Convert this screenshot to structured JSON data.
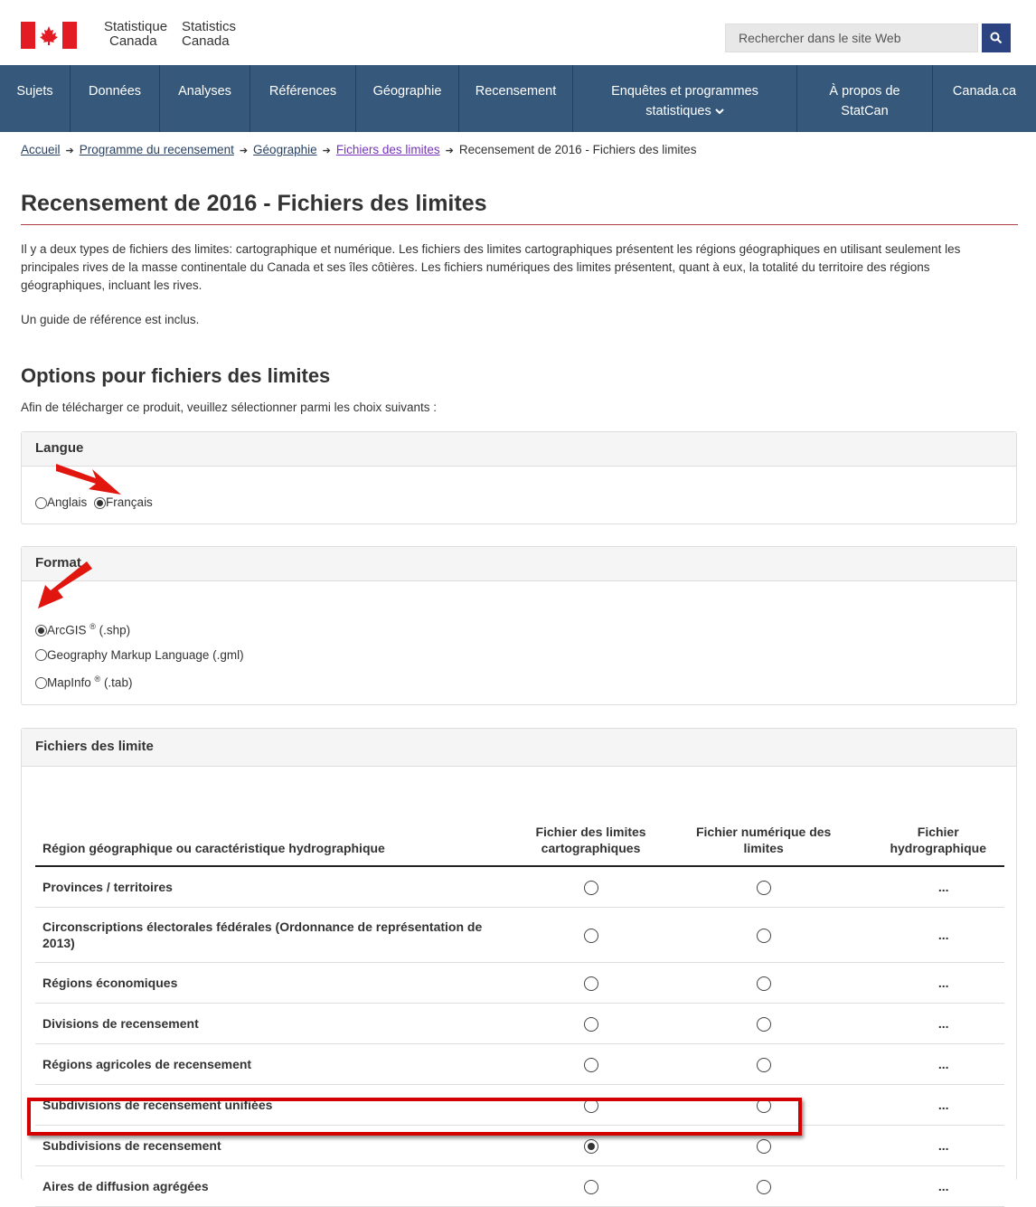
{
  "header": {
    "signature_fr": [
      "Statistique",
      "Canada"
    ],
    "signature_en": [
      "Statistics",
      "Canada"
    ],
    "search_placeholder": "Rechercher dans le site Web"
  },
  "nav": [
    {
      "label": "Sujets",
      "sub": ""
    },
    {
      "label": "Données",
      "sub": ""
    },
    {
      "label": "Analyses",
      "sub": ""
    },
    {
      "label": "Références",
      "sub": ""
    },
    {
      "label": "Géographie",
      "sub": ""
    },
    {
      "label": "Recensement",
      "sub": ""
    },
    {
      "label": "Enquêtes et programmes",
      "sub": "statistiques"
    },
    {
      "label": "À propos de",
      "sub": "StatCan"
    },
    {
      "label": "Canada.ca",
      "sub": ""
    }
  ],
  "breadcrumb": {
    "items": [
      "Accueil",
      "Programme du recensement",
      "Géographie",
      "Fichiers des limites"
    ],
    "current": "Recensement de 2016 - Fichiers des limites"
  },
  "page": {
    "title": "Recensement de 2016 - Fichiers des limites",
    "intro": "Il y a deux types de fichiers des limites: cartographique et numérique. Les fichiers des limites cartographiques présentent les régions géographiques en utilisant seulement les principales rives de la masse continentale du Canada et ses îles côtières. Les fichiers numériques des limites présentent, quant à eux, la totalité du territoire des régions géographiques, incluant les rives.",
    "intro2": "Un guide de référence est inclus.",
    "options_title": "Options pour fichiers des limites",
    "instructions": "Afin de télécharger ce produit, veuillez sélectionner parmi les choix suivants :"
  },
  "langue": {
    "title": "Langue",
    "options": [
      {
        "label": "Anglais",
        "selected": false
      },
      {
        "label": "Français",
        "selected": true
      }
    ]
  },
  "format": {
    "title": "Format",
    "options": [
      {
        "label": "ArcGIS",
        "mark": "®",
        "ext": " (.shp)",
        "selected": true
      },
      {
        "label": "Geography Markup Language (.gml)",
        "mark": "",
        "ext": "",
        "selected": false
      },
      {
        "label": "MapInfo",
        "mark": "®",
        "ext": " (.tab)",
        "selected": false
      }
    ]
  },
  "fichiers": {
    "title": "Fichiers des limite",
    "columns": [
      "Région géographique ou caractéristique hydrographique",
      "Fichier des limites cartographiques",
      "Fichier numérique des limites",
      "Fichier hydrographique"
    ],
    "rows": [
      {
        "region": "Provinces / territoires",
        "carto": false,
        "numerique": false,
        "hydro": "..."
      },
      {
        "region": "Circonscriptions électorales fédérales (Ordonnance de représentation de 2013)",
        "carto": false,
        "numerique": false,
        "hydro": "..."
      },
      {
        "region": "Régions économiques",
        "carto": false,
        "numerique": false,
        "hydro": "..."
      },
      {
        "region": "Divisions de recensement",
        "carto": false,
        "numerique": false,
        "hydro": "..."
      },
      {
        "region": "Régions agricoles de recensement",
        "carto": false,
        "numerique": false,
        "hydro": "..."
      },
      {
        "region": "Subdivisions de recensement unifiées",
        "carto": false,
        "numerique": false,
        "hydro": "..."
      },
      {
        "region": "Subdivisions de recensement",
        "carto": true,
        "numerique": false,
        "hydro": "..."
      },
      {
        "region": "Aires de diffusion agrégées",
        "carto": false,
        "numerique": false,
        "hydro": "..."
      }
    ]
  },
  "colors": {
    "nav_bg": "#36587a",
    "flag_red": "#e31c23",
    "search_btn": "#2b4380",
    "highlight": "#d40000",
    "arrow": "#e0160f"
  }
}
